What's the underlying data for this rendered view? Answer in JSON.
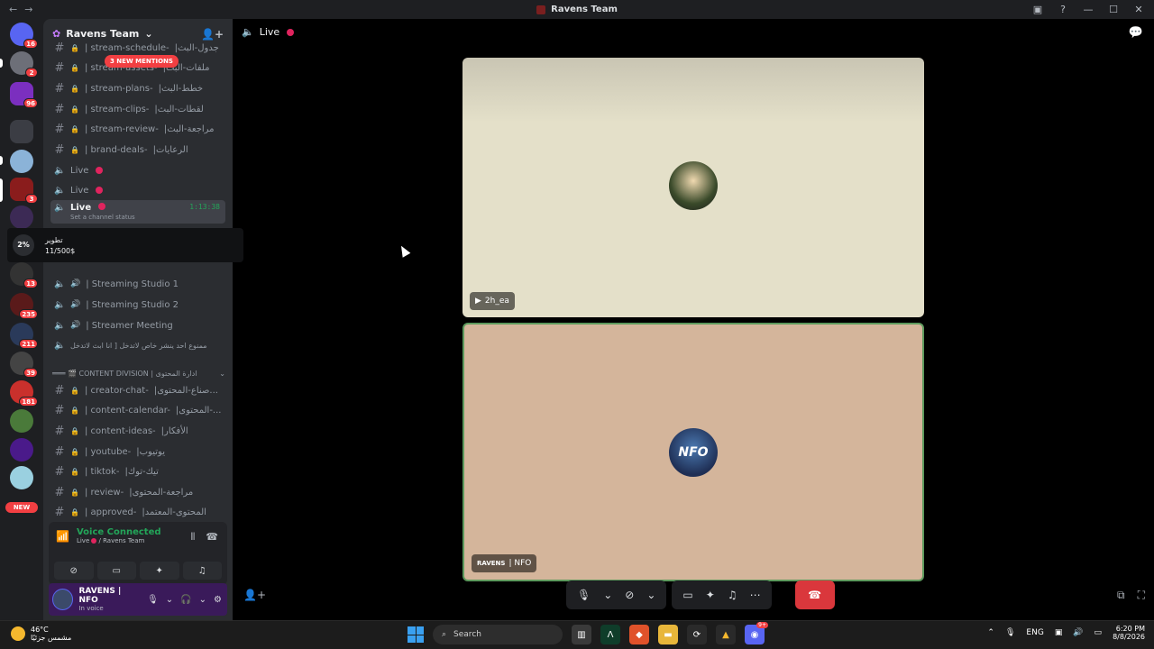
{
  "window": {
    "title": "Ravens Team",
    "back": "←",
    "forward": "→"
  },
  "titlebar_icons": [
    "inbox-icon",
    "help-icon"
  ],
  "window_controls": {
    "minimize": "—",
    "maximize": "☐",
    "close": "✕"
  },
  "rail": {
    "badges": [
      "16",
      "2",
      "96",
      "3",
      "13",
      "235",
      "211",
      "39",
      "181"
    ],
    "new_label": "NEW"
  },
  "server": {
    "name": "Ravens Team",
    "chevron": "⌄"
  },
  "mentions_pill": "3 NEW MENTIONS",
  "text_channels_top": [
    {
      "name": "| stream-schedule-",
      "arabic": "|جدول-البث"
    },
    {
      "name": "| stream-assets-",
      "arabic": "|ملفات-البث"
    },
    {
      "name": "| stream-plans-",
      "arabic": "|خطط-البث"
    },
    {
      "name": "| stream-clips-",
      "arabic": "|لقطات-البث"
    },
    {
      "name": "| stream-review-",
      "arabic": "|مراجعة-البث"
    },
    {
      "name": "| brand-deals-",
      "arabic": "|الرعايات"
    }
  ],
  "voice_live": [
    {
      "name": "Live"
    },
    {
      "name": "Live"
    }
  ],
  "active_channel": {
    "name": "Live",
    "time": "1:13:38",
    "status": "Set a channel status"
  },
  "tooltip": {
    "pct": "2%",
    "line1": "تطوير",
    "line2": "11/500$"
  },
  "voice_channels": [
    {
      "name": "| Streaming Studio 1"
    },
    {
      "name": "| Streaming Studio 2"
    },
    {
      "name": "| Streamer Meeting"
    },
    {
      "name": "ممنوع احد ينشر خاص لاتدخل [ انا ابث لاتدخل"
    }
  ],
  "category": {
    "name": "═══ 🎬 CONTENT DIVISION | ادارة المحتوى",
    "chevron": "⌄"
  },
  "content_channels": [
    {
      "name": "| creator-chat-",
      "arabic": "|صناع-المحتوى..."
    },
    {
      "name": "| content-calendar-",
      "arabic": "|المحتوى-..."
    },
    {
      "name": "| content-ideas-",
      "arabic": "|الأفكار"
    },
    {
      "name": "| youtube-",
      "arabic": "|يوتيوب"
    },
    {
      "name": "| tiktok-",
      "arabic": "|تيك-توك"
    },
    {
      "name": "| review-",
      "arabic": "|مراجعة-المحتوى"
    },
    {
      "name": "| approved-",
      "arabic": "|المحتوى-المعتمد"
    }
  ],
  "voice_panel": {
    "title": "Voice Connected",
    "channel": "Live",
    "server": "/ Ravens Team"
  },
  "user": {
    "name": "RAVENS | NFO",
    "status": "In voice"
  },
  "main": {
    "channel_title": "Live",
    "tiles": [
      {
        "label": "2h_ea",
        "platform_icon": "playstation-icon"
      },
      {
        "tag": "RAVENS",
        "label": "| NFO",
        "avatar_text": "NFO"
      }
    ]
  },
  "taskbar": {
    "weather_temp": "46°C",
    "weather_desc": "مشمس جزئيًا",
    "search_placeholder": "Search",
    "lang": "ENG",
    "time": "6:20 PM",
    "date": "8/8/2026",
    "discord_badge": "9+"
  }
}
